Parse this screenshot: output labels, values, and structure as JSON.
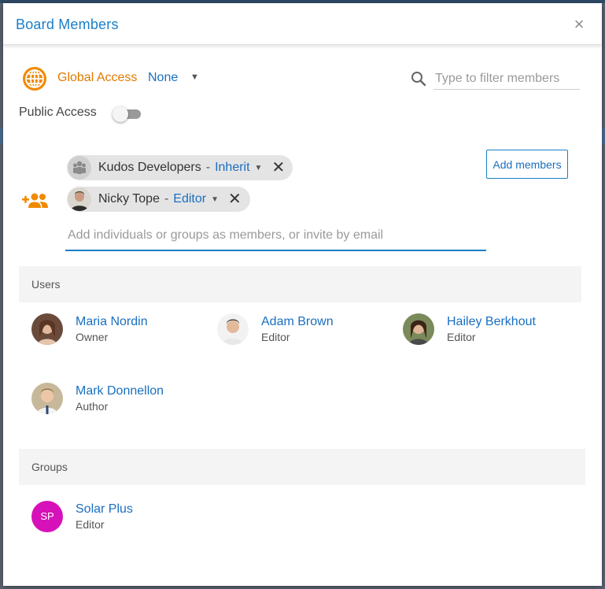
{
  "dialog": {
    "title": "Board Members",
    "close_glyph": "×"
  },
  "access": {
    "global_label": "Global Access",
    "global_value": "None",
    "public_label": "Public Access",
    "public_enabled": false
  },
  "filter": {
    "placeholder": "Type to filter members"
  },
  "pending_members": [
    {
      "name": "Kudos Developers",
      "role": "Inherit",
      "avatar": "group-icon"
    },
    {
      "name": "Nicky Tope",
      "role": "Editor",
      "avatar": "user-photo"
    }
  ],
  "invite": {
    "placeholder": "Add individuals or groups as members, or invite by email",
    "add_button": "Add members"
  },
  "users": {
    "header": "Users",
    "items": [
      {
        "name": "Maria Nordin",
        "role": "Owner"
      },
      {
        "name": "Adam Brown",
        "role": "Editor"
      },
      {
        "name": "Hailey Berkhout",
        "role": "Editor"
      },
      {
        "name": "Mark Donnellon",
        "role": "Author"
      }
    ]
  },
  "groups": {
    "header": "Groups",
    "items": [
      {
        "name": "Solar Plus",
        "role": "Editor",
        "initials": "SP",
        "color": "#d611b9"
      }
    ]
  },
  "colors": {
    "accent": "#1a7fc9",
    "global_access": "#e07b00"
  }
}
